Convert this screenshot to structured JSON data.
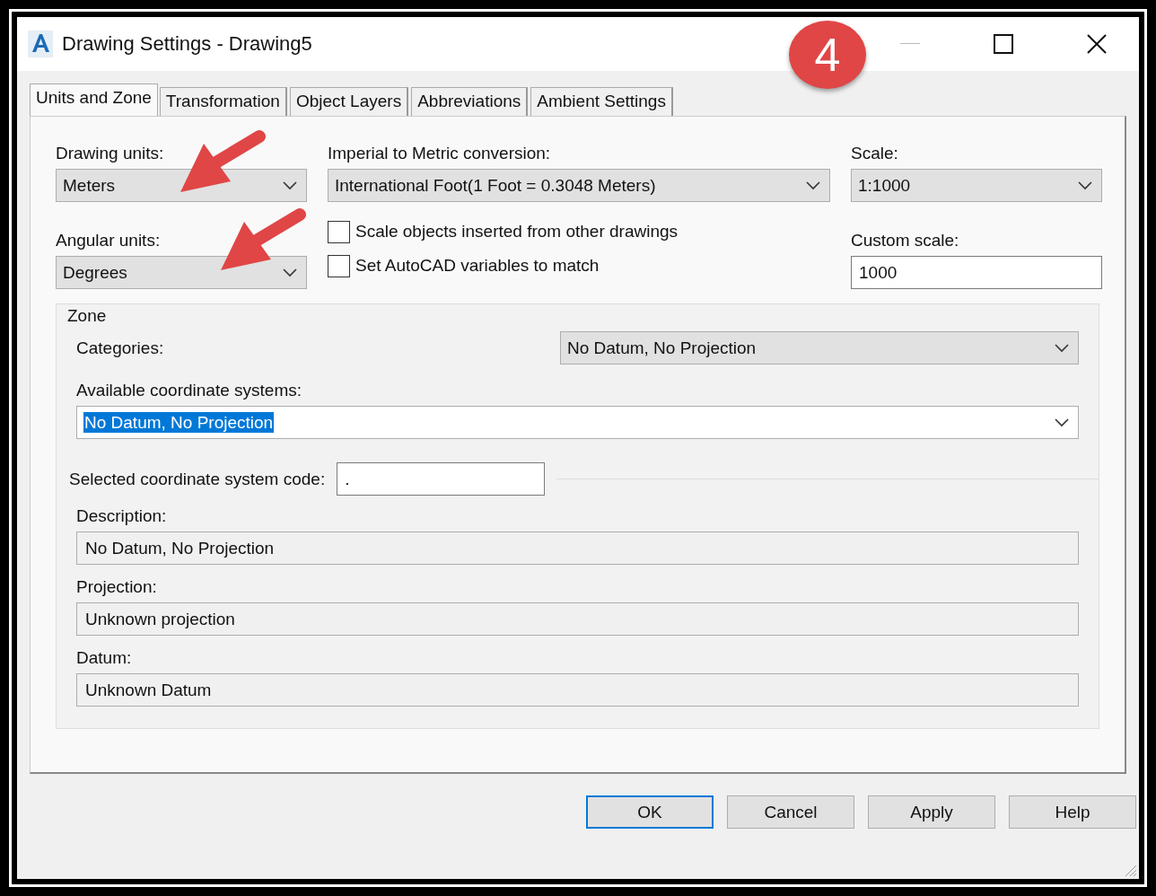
{
  "window": {
    "title": "Drawing Settings - Drawing5"
  },
  "annotation_badge": "4",
  "tabs": [
    {
      "label": "Units and Zone",
      "selected": true
    },
    {
      "label": "Transformation",
      "selected": false
    },
    {
      "label": "Object Layers",
      "selected": false
    },
    {
      "label": "Abbreviations",
      "selected": false
    },
    {
      "label": "Ambient Settings",
      "selected": false
    }
  ],
  "drawing_units": {
    "label": "Drawing units:",
    "value": "Meters"
  },
  "angular_units": {
    "label": "Angular units:",
    "value": "Degrees"
  },
  "conversion": {
    "label": "Imperial to Metric conversion:",
    "value": "International Foot(1 Foot = 0.3048 Meters)"
  },
  "checkboxes": [
    {
      "label": "Scale objects inserted from other drawings",
      "checked": false
    },
    {
      "label": "Set AutoCAD variables to match",
      "checked": false
    }
  ],
  "scale": {
    "label": "Scale:",
    "value": "1:1000"
  },
  "custom_scale": {
    "label": "Custom scale:",
    "value": "1000"
  },
  "zone": {
    "title": "Zone",
    "categories": {
      "label": "Categories:",
      "value": "No Datum, No Projection"
    },
    "available": {
      "label": "Available coordinate systems:",
      "value": "No Datum, No Projection",
      "text_selected": true
    },
    "code": {
      "label": "Selected coordinate system code:",
      "value": "."
    },
    "details": [
      {
        "label": "Description:",
        "value": "No Datum, No Projection"
      },
      {
        "label": "Projection:",
        "value": "Unknown projection"
      },
      {
        "label": "Datum:",
        "value": "Unknown Datum"
      }
    ]
  },
  "buttons": [
    {
      "label": "OK",
      "default": true
    },
    {
      "label": "Cancel",
      "default": false
    },
    {
      "label": "Apply",
      "default": false
    },
    {
      "label": "Help",
      "default": false
    }
  ]
}
